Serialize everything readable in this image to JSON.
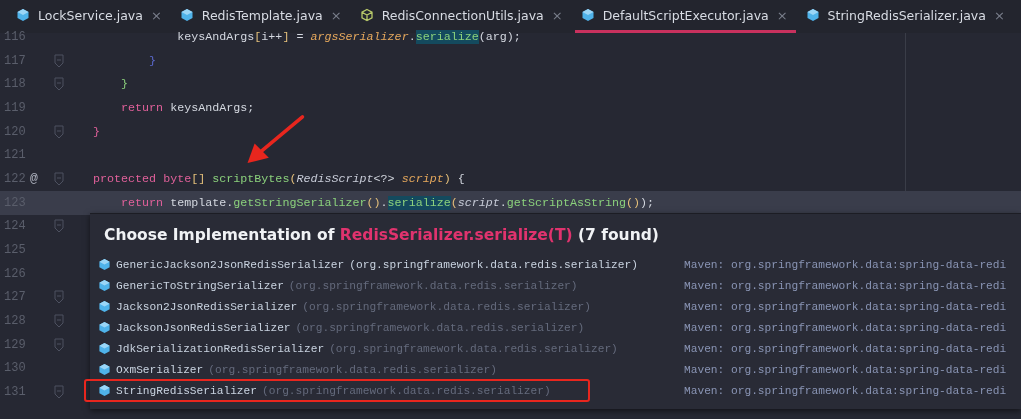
{
  "tabs": [
    {
      "label": "LockService.java",
      "kind": "class",
      "selected": false
    },
    {
      "label": "RedisTemplate.java",
      "kind": "class",
      "selected": false
    },
    {
      "label": "RedisConnectionUtils.java",
      "kind": "abstract",
      "selected": false
    },
    {
      "label": "DefaultScriptExecutor.java",
      "kind": "class",
      "selected": true
    },
    {
      "label": "StringRedisSerializer.java",
      "kind": "class",
      "selected": false
    }
  ],
  "close_glyph": "×",
  "gutter": [
    {
      "number": "116",
      "fold": false
    },
    {
      "number": "117",
      "fold": true
    },
    {
      "number": "118",
      "fold": true
    },
    {
      "number": "119",
      "fold": false
    },
    {
      "number": "120",
      "fold": true
    },
    {
      "number": "121",
      "fold": false
    },
    {
      "number": "122",
      "fold": true,
      "marker": "@"
    },
    {
      "number": "123",
      "fold": false
    },
    {
      "number": "124",
      "fold": true
    },
    {
      "number": "125",
      "fold": false
    },
    {
      "number": "126",
      "fold": false
    },
    {
      "number": "127",
      "fold": true
    },
    {
      "number": "128",
      "fold": true
    },
    {
      "number": "129",
      "fold": true
    },
    {
      "number": "130",
      "fold": false
    },
    {
      "number": "131",
      "fold": true
    }
  ],
  "code": [
    {
      "current": false,
      "tokens": [
        {
          "t": "            keysAndArgs",
          "kind": "plain"
        },
        {
          "t": "[",
          "kind": "bracket"
        },
        {
          "t": "i",
          "kind": "plain"
        },
        {
          "t": "++",
          "kind": "plain"
        },
        {
          "t": "]",
          "kind": "bracket"
        },
        {
          "t": " = ",
          "kind": "plain"
        },
        {
          "t": "argsSerializer",
          "kind": "field"
        },
        {
          "t": ".",
          "kind": "plain"
        },
        {
          "t": "serialize",
          "kind": "match"
        },
        {
          "t": "(arg);",
          "kind": "plain"
        }
      ]
    },
    {
      "current": false,
      "tokens": [
        {
          "t": "        }",
          "kind": "brace"
        }
      ]
    },
    {
      "current": false,
      "tokens": [
        {
          "t": "    }",
          "kind": "brace2"
        }
      ]
    },
    {
      "current": false,
      "tokens": [
        {
          "t": "    return",
          "kind": "kw"
        },
        {
          "t": " keysAndArgs;",
          "kind": "plain"
        }
      ]
    },
    {
      "current": false,
      "tokens": [
        {
          "t": "}",
          "kind": "kw"
        }
      ]
    },
    {
      "current": false
    },
    {
      "current": false,
      "tokens": [
        {
          "t": "protected byte",
          "kind": "kw"
        },
        {
          "t": "[]",
          "kind": "bracket"
        },
        {
          "t": " scriptBytes",
          "kind": "fn"
        },
        {
          "t": "(",
          "kind": "bracket"
        },
        {
          "t": "RedisScript",
          "kind": "type"
        },
        {
          "t": "<?> ",
          "kind": "plain"
        },
        {
          "t": "script",
          "kind": "field"
        },
        {
          "t": ")",
          "kind": "bracket"
        },
        {
          "t": " {",
          "kind": "plain"
        }
      ]
    },
    {
      "current": true,
      "tokens": [
        {
          "t": "    return",
          "kind": "kw"
        },
        {
          "t": " template.",
          "kind": "plain"
        },
        {
          "t": "getStringSerializer",
          "kind": "fn"
        },
        {
          "t": "()",
          "kind": "bracket"
        },
        {
          "t": ".",
          "kind": "plain"
        },
        {
          "t": "serialize",
          "kind": "match"
        },
        {
          "t": "(",
          "kind": "bracket"
        },
        {
          "t": "script",
          "kind": "type"
        },
        {
          "t": ".",
          "kind": "plain"
        },
        {
          "t": "getScriptAsString",
          "kind": "fn"
        },
        {
          "t": "()",
          "kind": "bracket"
        },
        {
          "t": ");",
          "kind": "plain"
        }
      ]
    }
  ],
  "popup": {
    "title_prefix": "Choose Implementation of ",
    "title_method": "RedisSerializer.serialize(T)",
    "title_suffix": " (7 found)",
    "items": [
      {
        "name": "GenericJackson2JsonRedisSerializer",
        "package": "(org.springframework.data.redis.serializer)",
        "package_dim": false,
        "source": "Maven: org.springframework.data:spring-data-redi",
        "outlined": false
      },
      {
        "name": "GenericToStringSerializer",
        "package": "(org.springframework.data.redis.serializer)",
        "package_dim": true,
        "source": "Maven: org.springframework.data:spring-data-redi",
        "outlined": false
      },
      {
        "name": "Jackson2JsonRedisSerializer",
        "package": "(org.springframework.data.redis.serializer)",
        "package_dim": true,
        "source": "Maven: org.springframework.data:spring-data-redi",
        "outlined": false
      },
      {
        "name": "JacksonJsonRedisSerializer",
        "package": "(org.springframework.data.redis.serializer)",
        "package_dim": true,
        "source": "Maven: org.springframework.data:spring-data-redi",
        "outlined": false
      },
      {
        "name": "JdkSerializationRedisSerializer",
        "package": "(org.springframework.data.redis.serializer)",
        "package_dim": true,
        "source": "Maven: org.springframework.data:spring-data-redi",
        "outlined": false
      },
      {
        "name": "OxmSerializer",
        "package": "(org.springframework.data.redis.serializer)",
        "package_dim": true,
        "source": "Maven: org.springframework.data:spring-data-redi",
        "outlined": false
      },
      {
        "name": "StringRedisSerializer",
        "package": "(org.springframework.data.redis.serializer)",
        "package_dim": true,
        "source": "Maven: org.springframework.data:spring-data-redi",
        "outlined": true
      }
    ]
  }
}
